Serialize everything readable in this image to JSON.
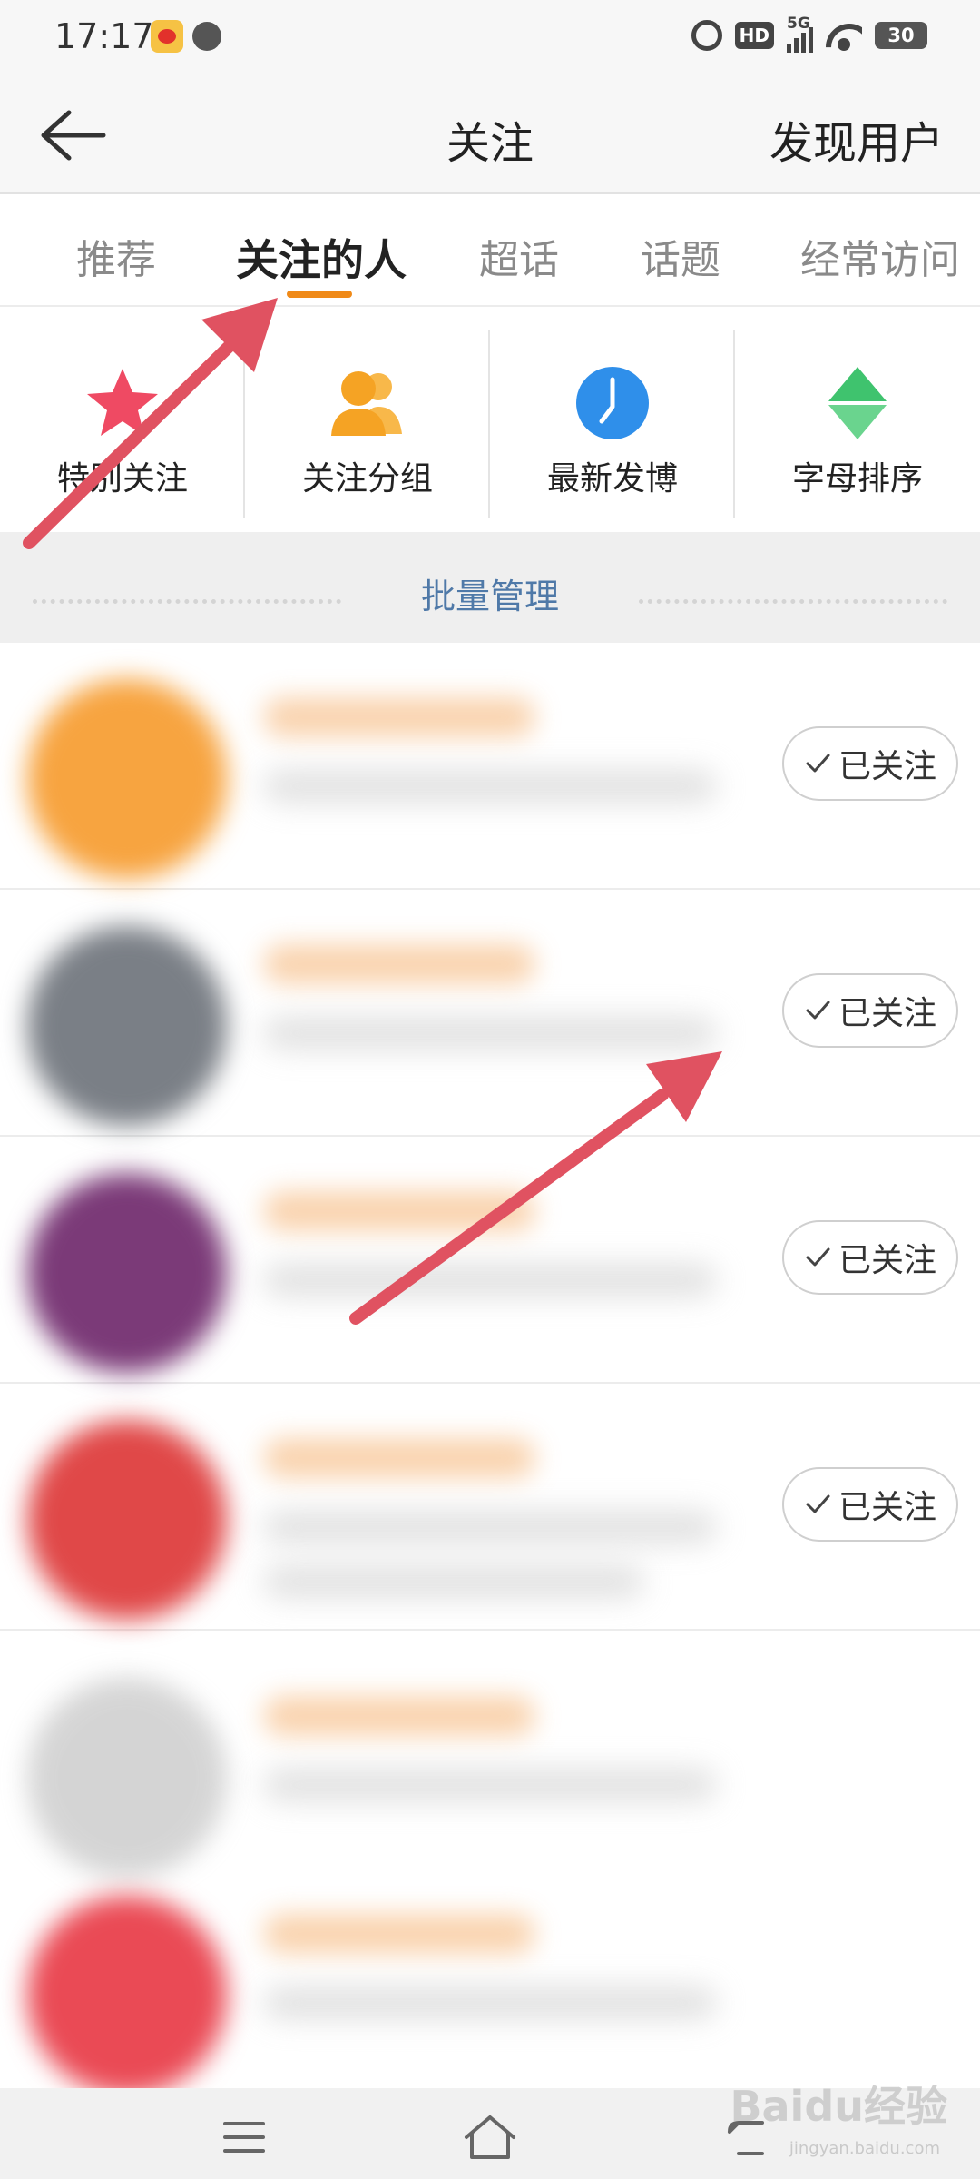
{
  "status_bar": {
    "time": "17:17",
    "network": "5G",
    "hd": "HD",
    "battery": "30"
  },
  "nav": {
    "title": "关注",
    "action": "发现用户"
  },
  "tabs": [
    {
      "label": "推荐"
    },
    {
      "label": "关注的人"
    },
    {
      "label": "超话"
    },
    {
      "label": "话题"
    },
    {
      "label": "经常访问"
    }
  ],
  "active_tab": "关注的人",
  "quick_entries": [
    {
      "label": "特别关注",
      "icon": "star-icon"
    },
    {
      "label": "关注分组",
      "icon": "group-icon"
    },
    {
      "label": "最新发博",
      "icon": "clock-icon"
    },
    {
      "label": "字母排序",
      "icon": "sort-icon"
    }
  ],
  "batch_manage": "批量管理",
  "users": [
    {
      "follow_label": "已关注",
      "avatar_color": "#f7a440"
    },
    {
      "follow_label": "已关注",
      "avatar_color": "#7a7f86"
    },
    {
      "follow_label": "已关注",
      "avatar_color": "#7b3a78"
    },
    {
      "follow_label": "已关注",
      "avatar_color": "#e04848"
    }
  ],
  "watermark": {
    "text": "Baidu经验",
    "sub": "jingyan.baidu.com"
  },
  "colors": {
    "accent": "#f08a18",
    "arrow": "#e05261",
    "batch": "#4f79a8"
  }
}
